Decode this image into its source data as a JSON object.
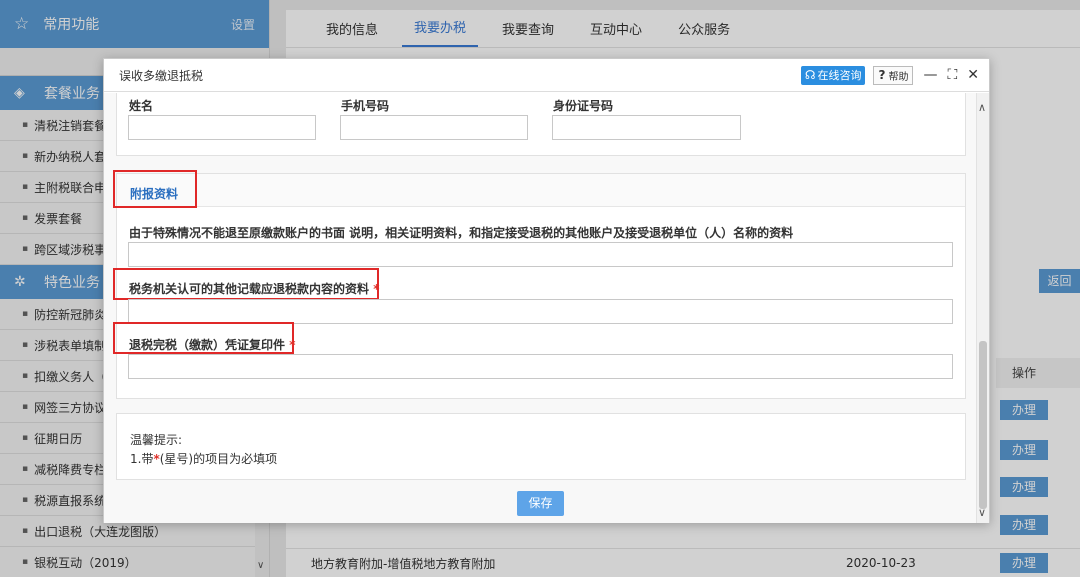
{
  "sidebar": {
    "common_title": "常用功能",
    "settings_label": "设置",
    "section1_title": "套餐业务",
    "section1_items": [
      "清税注销套餐",
      "新办纳税人套餐",
      "主附税联合申报",
      "发票套餐",
      "跨区域涉税事项"
    ],
    "section2_title": "特色业务",
    "section2_items": [
      "防控新冠肺炎",
      "涉税表单填制",
      "扣缴义务人（",
      "网签三方协议",
      "征期日历",
      "减税降费专栏",
      "税源直报系统",
      "出口退税（大连龙图版）",
      "银税互动（2019）"
    ]
  },
  "tabs": [
    {
      "label": "我的信息",
      "active": false
    },
    {
      "label": "我要办税",
      "active": true
    },
    {
      "label": "我要查询",
      "active": false
    },
    {
      "label": "互动中心",
      "active": false
    },
    {
      "label": "公众服务",
      "active": false
    }
  ],
  "main": {
    "back_label": "返回",
    "op_header": "操作",
    "handle_label": "办理",
    "row_name": "地方教育附加-增值税地方教育附加",
    "row_date": "2020-10-23"
  },
  "modal": {
    "title": "误收多缴退抵税",
    "online_label": "在线咨询",
    "help_label": "帮助",
    "fields": {
      "name_label": "姓名",
      "phone_label": "手机号码",
      "id_label": "身份证号码"
    },
    "attach_title": "附报资料",
    "doc1_label": "由于特殊情况不能退至原缴款账户的书面 说明，相关证明资料，和指定接受退税的其他账户及接受退税单位（人）名称的资料",
    "doc2_label": "税务机关认可的其他记载应退税款内容的资料",
    "doc3_label": "退税完税（缴款）凭证复印件",
    "required_mark": "*",
    "tip_title": "温馨提示:",
    "tip_prefix": "1.带",
    "tip_suffix": "(星号)的项目为必填项",
    "save_label": "保存"
  },
  "colors": {
    "accent": "#5b9bd5",
    "link": "#2b6fc0",
    "required": "#e0302a",
    "highlight_box": "#e02828"
  }
}
